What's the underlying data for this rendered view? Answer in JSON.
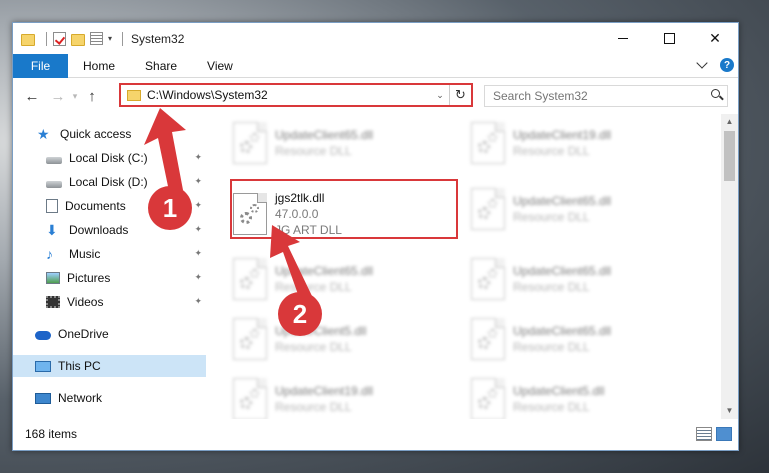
{
  "window": {
    "title": "System32",
    "controls": {
      "minimize": "—",
      "maximize": "☐",
      "close": "✕"
    }
  },
  "ribbon": {
    "tabs": [
      "File",
      "Home",
      "Share",
      "View"
    ],
    "help": "?"
  },
  "nav": {
    "back": "←",
    "forward": "→",
    "up": "↑"
  },
  "address": {
    "path": "C:\\Windows\\System32",
    "dropdown": "⌄",
    "refresh": "↻"
  },
  "search": {
    "placeholder": "Search System32"
  },
  "sidebar": {
    "items": [
      {
        "label": "Quick access",
        "icon": "star-icon"
      },
      {
        "label": "Local Disk (C:)",
        "icon": "disk-icon",
        "pinned": true
      },
      {
        "label": "Local Disk (D:)",
        "icon": "disk-icon",
        "pinned": true
      },
      {
        "label": "Documents",
        "icon": "documents-icon",
        "pinned": true
      },
      {
        "label": "Downloads",
        "icon": "downloads-icon",
        "pinned": true
      },
      {
        "label": "Music",
        "icon": "music-icon",
        "pinned": true
      },
      {
        "label": "Pictures",
        "icon": "pictures-icon",
        "pinned": true
      },
      {
        "label": "Videos",
        "icon": "videos-icon",
        "pinned": true
      },
      {
        "label": "OneDrive",
        "icon": "onedrive-icon"
      },
      {
        "label": "This PC",
        "icon": "pc-icon",
        "selected": true
      },
      {
        "label": "Network",
        "icon": "network-icon"
      }
    ],
    "pin_glyph": "📌"
  },
  "files": {
    "left": [
      {
        "name": "UpdateClient65.dll",
        "sub": "Resource DLL"
      },
      {
        "name": "jgs2tlk.dll",
        "sub": "47.0.0.0",
        "sub2": "JG ART DLL"
      },
      {
        "name": "UpdateClient65.dll",
        "sub": "Resource DLL"
      },
      {
        "name": "UpdateClient5.dll",
        "sub": "Resource DLL"
      },
      {
        "name": "UpdateClient19.dll",
        "sub": "Resource DLL"
      }
    ],
    "right": [
      {
        "name": "UpdateClient19.dll",
        "sub": "Resource DLL"
      },
      {
        "name": "UpdateClient65.dll",
        "sub": "Resource DLL"
      },
      {
        "name": "UpdateClient65.dll",
        "sub": "Resource DLL"
      },
      {
        "name": "UpdateClient65.dll",
        "sub": "Resource DLL"
      },
      {
        "name": "UpdateClient5.dll",
        "sub": "Resource DLL"
      }
    ]
  },
  "status": {
    "items_count": "168 items"
  },
  "callouts": [
    "1",
    "2"
  ],
  "colors": {
    "accent": "#1979ca",
    "highlight_red": "#d9383a",
    "selected_bg": "#cce4f7"
  }
}
